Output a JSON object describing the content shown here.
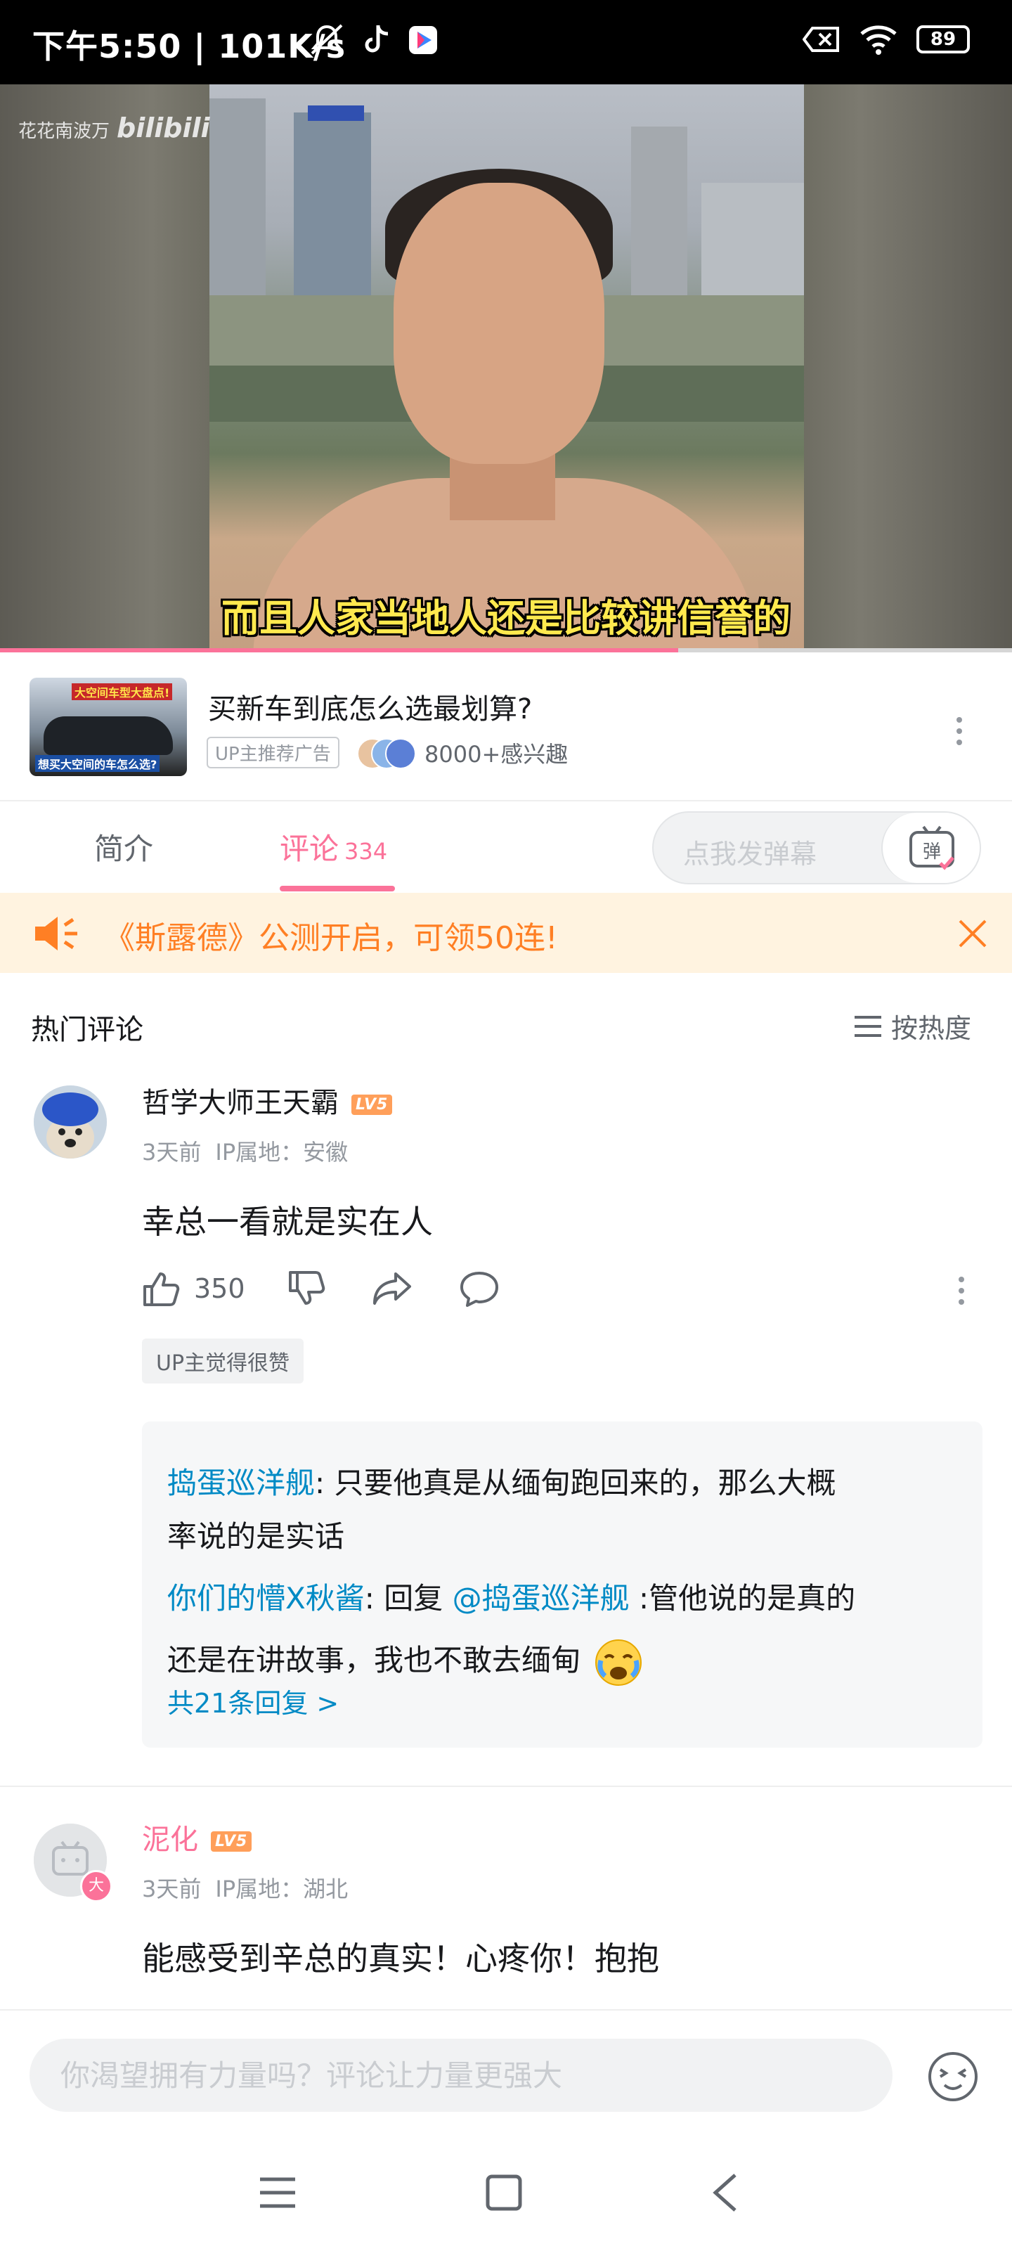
{
  "status_bar": {
    "time": "下午5:50 | 101K/s",
    "battery": "89"
  },
  "video": {
    "watermark_text": "花花南波万",
    "watermark_logo": "bilibili",
    "subtitle": "而且人家当地人还是比较讲信誉的",
    "progress_fraction": 0.67
  },
  "ad": {
    "thumb_caption_top": "大空间车型大盘点!",
    "thumb_caption_bottom": "想买大空间的车怎么选?",
    "title": "买新车到底怎么选最划算?",
    "tag": "UP主推荐广告",
    "interest": "8000+感兴趣"
  },
  "tabs": {
    "intro": "简介",
    "comments": "评论",
    "comments_count": "334",
    "danmaku_placeholder": "点我发弹幕",
    "danmaku_button": "弹"
  },
  "notice": {
    "text": "《斯露德》公测开启，可领50连!"
  },
  "comments_section": {
    "header": "热门评论",
    "sort_label": "按热度",
    "comments": [
      {
        "username": "哲学大师王天霸",
        "level": "LV5",
        "time": "3天前",
        "ip": "IP属地：安徽",
        "text": "幸总一看就是实在人",
        "likes": "350",
        "up_badge": "UP主觉得很赞",
        "replies": [
          {
            "name": "捣蛋巡洋舰",
            "sep": ": ",
            "text_line1": "只要他真是从缅甸跑回来的，那么大概",
            "text_line2": "率说的是实话"
          },
          {
            "name": "你们的懵X秋酱",
            "sep": ": ",
            "prefix": "回复 ",
            "mention": "@捣蛋巡洋舰",
            "text_line1": " :管他说的是真的",
            "text_line2": "还是在讲故事，我也不敢去缅甸"
          }
        ],
        "more_replies": "共21条回复 >"
      },
      {
        "username": "泥化",
        "level": "LV5",
        "time": "3天前",
        "ip": "IP属地：湖北",
        "text": "能感受到辛总的真实！心疼你！抱抱",
        "avatar_badge": "大"
      }
    ]
  },
  "input": {
    "placeholder": "你渴望拥有力量吗？评论让力量更强大"
  },
  "colors": {
    "accent_pink": "#fb7299",
    "link_blue": "#008ac5",
    "notice_orange": "#ff7f24",
    "notice_bg": "#fff3e0",
    "level_orange": "#ff9f5a"
  },
  "icons": [
    "mute-icon",
    "tiktok-icon",
    "app-icon",
    "sim-x-icon",
    "wifi-icon",
    "battery-icon",
    "more-icon",
    "tv-icon",
    "speaker-icon",
    "close-icon",
    "sort-icon",
    "like-icon",
    "dislike-icon",
    "share-icon",
    "reply-icon",
    "emoji-icon",
    "menu-icon",
    "home-icon",
    "back-icon"
  ]
}
